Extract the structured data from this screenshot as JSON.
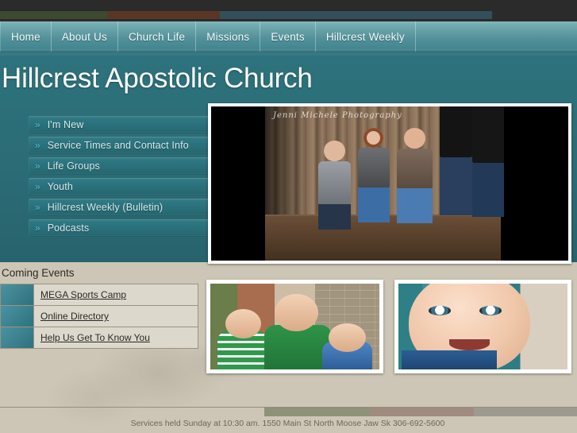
{
  "topbar": {
    "swatches": [
      {
        "name": "green",
        "color": "#3d4a31"
      },
      {
        "name": "brown",
        "color": "#593626"
      },
      {
        "name": "blue",
        "color": "#33505a"
      }
    ]
  },
  "nav": {
    "items": [
      {
        "label": "Home"
      },
      {
        "label": "About Us"
      },
      {
        "label": "Church Life"
      },
      {
        "label": "Missions"
      },
      {
        "label": "Events"
      },
      {
        "label": "Hillcrest Weekly"
      }
    ]
  },
  "header": {
    "site_title": "Hillcrest Apostolic Church",
    "accent_color": "#2b6b75"
  },
  "sidebar": {
    "arrow_glyph": "»",
    "items": [
      {
        "label": "I'm New"
      },
      {
        "label": "Service Times and Contact Info"
      },
      {
        "label": "Life Groups"
      },
      {
        "label": "Youth"
      },
      {
        "label": "Hillcrest Weekly (Bulletin)"
      },
      {
        "label": "Podcasts"
      }
    ]
  },
  "featured_photo": {
    "alt": "Family of five seated on wooden steps in front of a weathered log wall",
    "signature": "Jenni Michele Photography"
  },
  "photos": [
    {
      "name": "kids-and-man",
      "alt": "Smiling man in green polo shirt with two boys outdoors"
    },
    {
      "name": "baby",
      "alt": "Close-up of a smiling baby with blue eyes"
    }
  ],
  "events": {
    "title": "Coming Events",
    "items": [
      {
        "label": "MEGA Sports Camp"
      },
      {
        "label": "Online Directory"
      },
      {
        "label": "Help Us Get To Know You"
      }
    ]
  },
  "footer": {
    "text": "Services held Sunday at 10:30 am. 1550 Main St North Moose Jaw Sk 306-692-5600",
    "bars": [
      {
        "name": "olive",
        "color": "#8d9278"
      },
      {
        "name": "rose",
        "color": "#9f8b80"
      },
      {
        "name": "gray",
        "color": "#9d9a91"
      }
    ]
  }
}
